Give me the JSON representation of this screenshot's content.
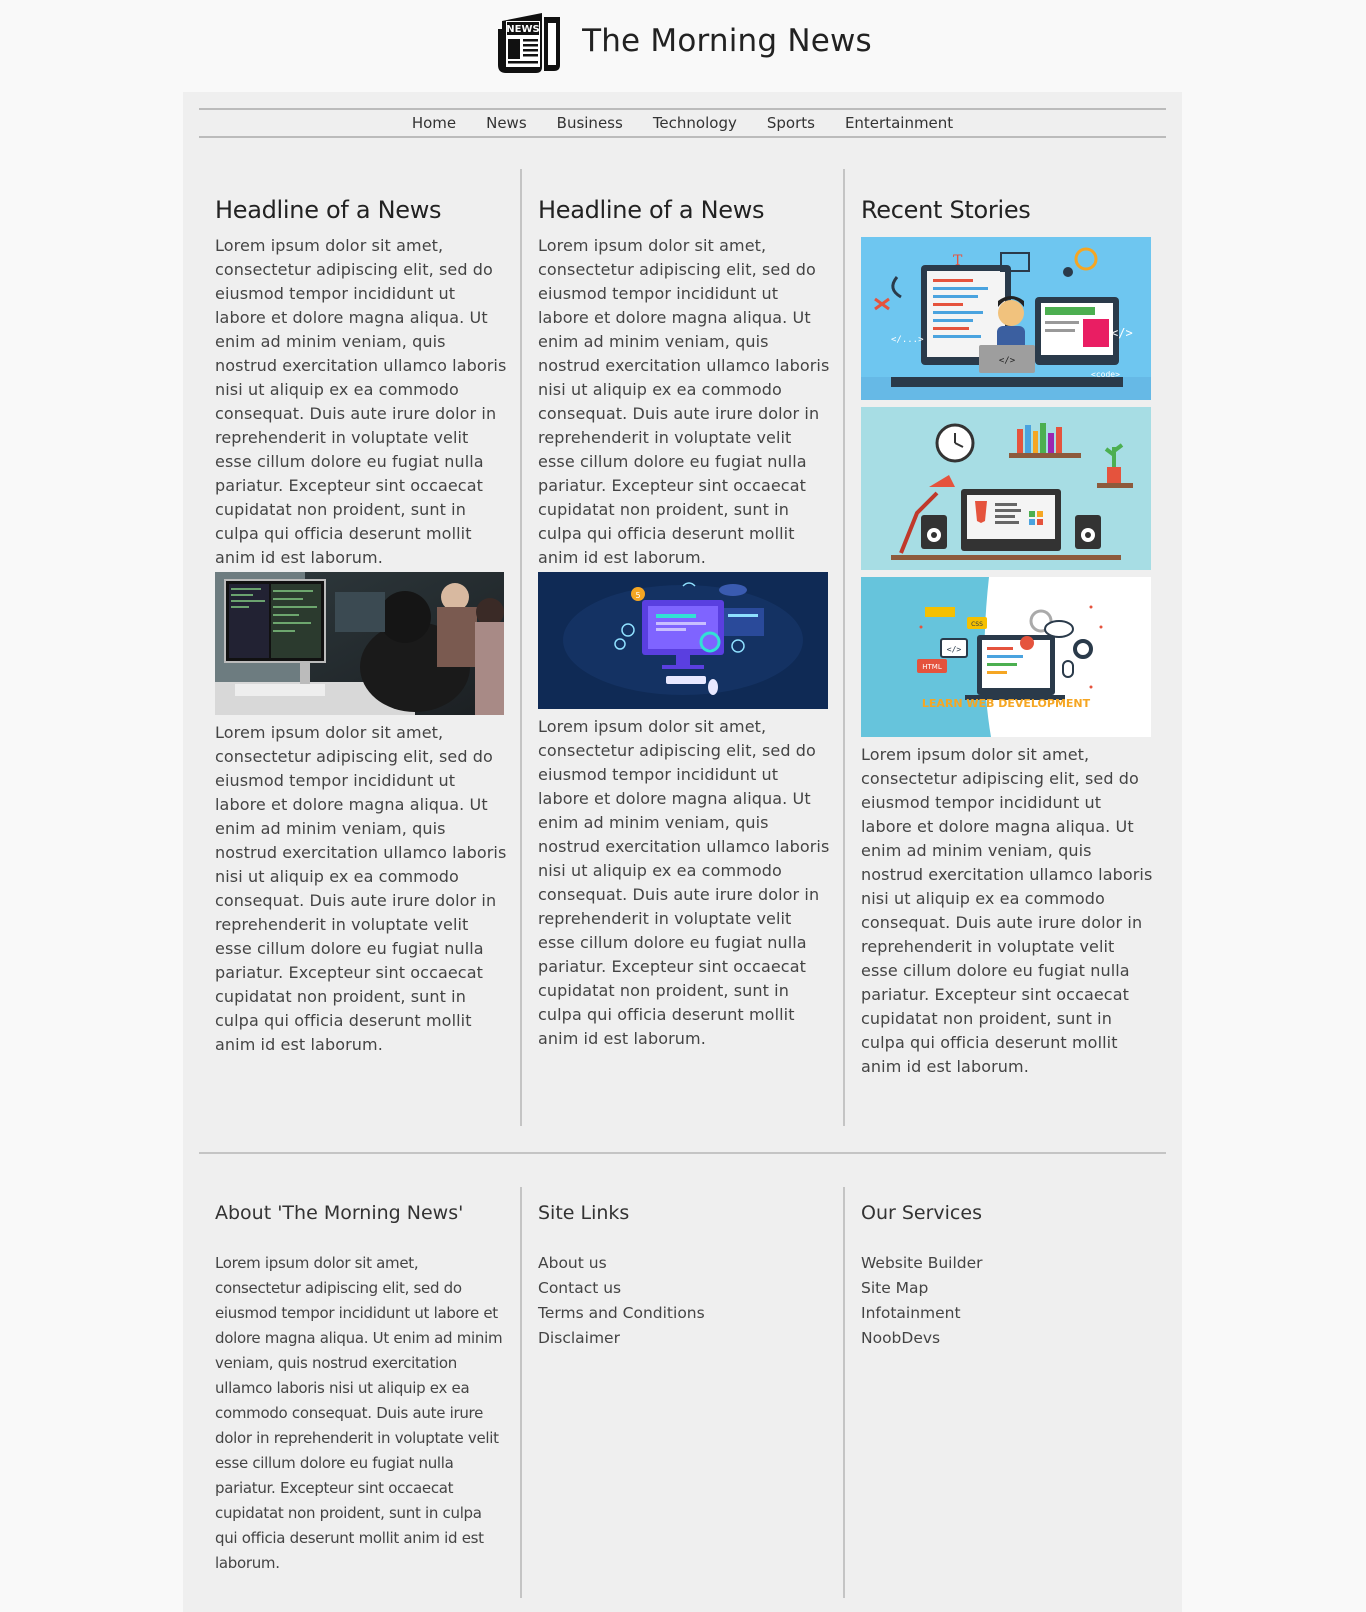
{
  "header": {
    "logo_text": "NEWS",
    "site_title": "The Morning News"
  },
  "nav": {
    "items": [
      "Home",
      "News",
      "Business",
      "Technology",
      "Sports",
      "Entertainment"
    ]
  },
  "columns": [
    {
      "heading": "Headline of a News",
      "paragraph1": "Lorem ipsum dolor sit amet, consectetur adipiscing elit, sed do eiusmod tempor incididunt ut labore et dolore magna aliqua. Ut enim ad minim veniam, quis nostrud exercitation ullamco laboris nisi ut aliquip ex ea commodo consequat. Duis aute irure dolor in reprehenderit in voluptate velit esse cillum dolore eu fugiat nulla pariatur. Excepteur sint occaecat cupidatat non proident, sunt in culpa qui officia deserunt mollit anim id est laborum.",
      "paragraph2": "Lorem ipsum dolor sit amet, consectetur adipiscing elit, sed do eiusmod tempor incididunt ut labore et dolore magna aliqua. Ut enim ad minim veniam, quis nostrud exercitation ullamco laboris nisi ut aliquip ex ea commodo consequat. Duis aute irure dolor in reprehenderit in voluptate velit esse cillum dolore eu fugiat nulla pariatur. Excepteur sint occaecat cupidatat non proident, sunt in culpa qui officia deserunt mollit anim id est laborum."
    },
    {
      "heading": "Headline of a News",
      "paragraph1": "Lorem ipsum dolor sit amet, consectetur adipiscing elit, sed do eiusmod tempor incididunt ut labore et dolore magna aliqua. Ut enim ad minim veniam, quis nostrud exercitation ullamco laboris nisi ut aliquip ex ea commodo consequat. Duis aute irure dolor in reprehenderit in voluptate velit esse cillum dolore eu fugiat nulla pariatur. Excepteur sint occaecat cupidatat non proident, sunt in culpa qui officia deserunt mollit anim id est laborum.",
      "paragraph2": "Lorem ipsum dolor sit amet, consectetur adipiscing elit, sed do eiusmod tempor incididunt ut labore et dolore magna aliqua. Ut enim ad minim veniam, quis nostrud exercitation ullamco laboris nisi ut aliquip ex ea commodo consequat. Duis aute irure dolor in reprehenderit in voluptate velit esse cillum dolore eu fugiat nulla pariatur. Excepteur sint occaecat cupidatat non proident, sunt in culpa qui officia deserunt mollit anim id est laborum."
    },
    {
      "heading": "Recent Stories",
      "paragraph": "Lorem ipsum dolor sit amet, consectetur adipiscing elit, sed do eiusmod tempor incididunt ut labore et dolore magna aliqua. Ut enim ad minim veniam, quis nostrud exercitation ullamco laboris nisi ut aliquip ex ea commodo consequat. Duis aute irure dolor in reprehenderit in voluptate velit esse cillum dolore eu fugiat nulla pariatur. Excepteur sint occaecat cupidatat non proident, sunt in culpa qui officia deserunt mollit anim id est laborum.",
      "story3_banner": "LEARN WEB DEVELOPMENT"
    }
  ],
  "footer": {
    "about": {
      "heading": "About 'The Morning News'",
      "text": "Lorem ipsum dolor sit amet, consectetur adipiscing elit, sed do eiusmod tempor incididunt ut labore et dolore magna aliqua. Ut enim ad minim veniam, quis nostrud exercitation ullamco laboris nisi ut aliquip ex ea commodo consequat. Duis aute irure dolor in reprehenderit in voluptate velit esse cillum dolore eu fugiat nulla pariatur. Excepteur sint occaecat cupidatat non proident, sunt in culpa qui officia deserunt mollit anim id est laborum."
    },
    "site_links": {
      "heading": "Site Links",
      "links": [
        "About us",
        "Contact us",
        "Terms and Conditions",
        "Disclaimer"
      ]
    },
    "services": {
      "heading": "Our Services",
      "links": [
        "Website Builder",
        "Site Map",
        "Infotainment",
        "NoobDevs"
      ]
    }
  },
  "colors": {
    "page_bg": "#f9f9f9",
    "container_bg": "#efefef",
    "divider": "#c4c4c4",
    "text": "#444444"
  }
}
